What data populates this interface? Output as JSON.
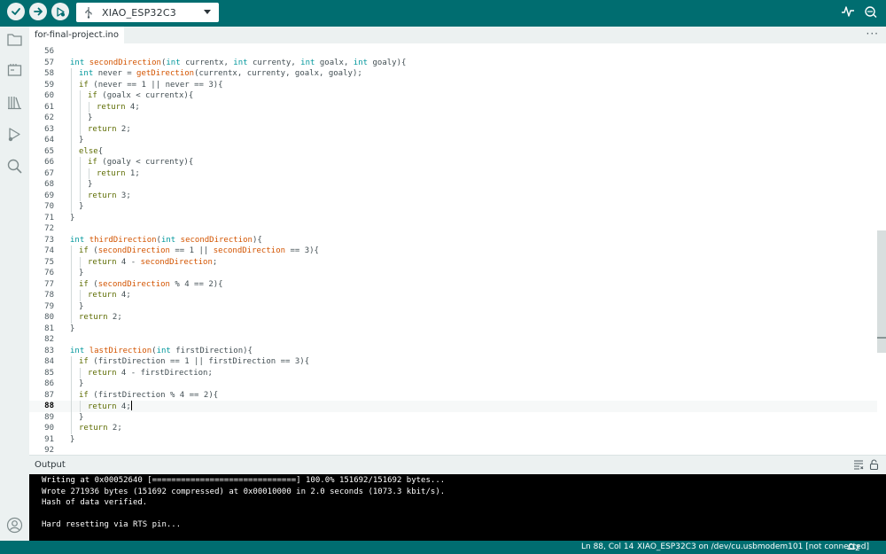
{
  "toolbar": {
    "verify_icon": "check-icon",
    "upload_icon": "arrow-right-icon",
    "debug_icon": "debug-play-icon",
    "board_name": "XIAO_ESP32C3",
    "serial_plotter_icon": "pulse-icon",
    "serial_monitor_icon": "magnifier-dots-icon"
  },
  "sidebar": {
    "items": [
      "folder-icon",
      "board-icon",
      "library-icon",
      "debug-icon",
      "search-icon"
    ],
    "bottom": "account-icon"
  },
  "tab": {
    "label": "for-final-project.ino",
    "more": "···"
  },
  "editor": {
    "lines": [
      {
        "n": "56",
        "indent": 0,
        "code": ""
      },
      {
        "n": "57",
        "indent": 0,
        "code": "int secondDirection(int currentx, int currenty, int goalx, int goaly){"
      },
      {
        "n": "58",
        "indent": 1,
        "code": "int never = getDirection(currentx, currenty, goalx, goaly);"
      },
      {
        "n": "59",
        "indent": 1,
        "code": "if (never == 1 || never == 3){"
      },
      {
        "n": "60",
        "indent": 2,
        "code": "if (goalx < currentx){"
      },
      {
        "n": "61",
        "indent": 3,
        "code": "return 4;"
      },
      {
        "n": "62",
        "indent": 2,
        "code": "}"
      },
      {
        "n": "63",
        "indent": 2,
        "code": "return 2;"
      },
      {
        "n": "64",
        "indent": 1,
        "code": "}"
      },
      {
        "n": "65",
        "indent": 1,
        "code": "else{"
      },
      {
        "n": "66",
        "indent": 2,
        "code": "if (goaly < currenty){"
      },
      {
        "n": "67",
        "indent": 3,
        "code": "return 1;"
      },
      {
        "n": "68",
        "indent": 2,
        "code": "}"
      },
      {
        "n": "69",
        "indent": 2,
        "code": "return 3;"
      },
      {
        "n": "70",
        "indent": 1,
        "code": "}"
      },
      {
        "n": "71",
        "indent": 0,
        "code": "}"
      },
      {
        "n": "72",
        "indent": 0,
        "code": ""
      },
      {
        "n": "73",
        "indent": 0,
        "code": "int thirdDirection(int secondDirection){"
      },
      {
        "n": "74",
        "indent": 1,
        "code": "if (secondDirection == 1 || secondDirection == 3){"
      },
      {
        "n": "75",
        "indent": 2,
        "code": "return 4 - secondDirection;"
      },
      {
        "n": "76",
        "indent": 1,
        "code": "}"
      },
      {
        "n": "77",
        "indent": 1,
        "code": "if (secondDirection % 4 == 2){"
      },
      {
        "n": "78",
        "indent": 2,
        "code": "return 4;"
      },
      {
        "n": "79",
        "indent": 1,
        "code": "}"
      },
      {
        "n": "80",
        "indent": 1,
        "code": "return 2;"
      },
      {
        "n": "81",
        "indent": 0,
        "code": "}"
      },
      {
        "n": "82",
        "indent": 0,
        "code": ""
      },
      {
        "n": "83",
        "indent": 0,
        "code": "int lastDirection(int firstDirection){"
      },
      {
        "n": "84",
        "indent": 1,
        "code": "if (firstDirection == 1 || firstDirection == 3){"
      },
      {
        "n": "85",
        "indent": 2,
        "code": "return 4 - firstDirection;"
      },
      {
        "n": "86",
        "indent": 1,
        "code": "}"
      },
      {
        "n": "87",
        "indent": 1,
        "code": "if (firstDirection % 4 == 2){"
      },
      {
        "n": "88",
        "indent": 2,
        "code": "return 4;",
        "current": true
      },
      {
        "n": "89",
        "indent": 1,
        "code": "}"
      },
      {
        "n": "90",
        "indent": 1,
        "code": "return 2;"
      },
      {
        "n": "91",
        "indent": 0,
        "code": "}"
      },
      {
        "n": "92",
        "indent": 0,
        "code": ""
      }
    ]
  },
  "output": {
    "title": "Output",
    "lines": [
      "Writing at 0x00052640 [==============================] 100.0% 151692/151692 bytes...",
      "Wrote 271936 bytes (151692 compressed) at 0x00010000 in 2.0 seconds (1073.3 kbit/s).",
      "Hash of data verified.",
      "",
      "Hard resetting via RTS pin..."
    ]
  },
  "status": {
    "position": "Ln 88, Col 14",
    "board": "XIAO_ESP32C3 on /dev/cu.usbmodem101 [not connected]",
    "notifications": "2"
  },
  "colors": {
    "accent": "#006d70",
    "keyword_type": "#00979c",
    "keyword_control": "#5e6d03",
    "function": "#d35400"
  }
}
